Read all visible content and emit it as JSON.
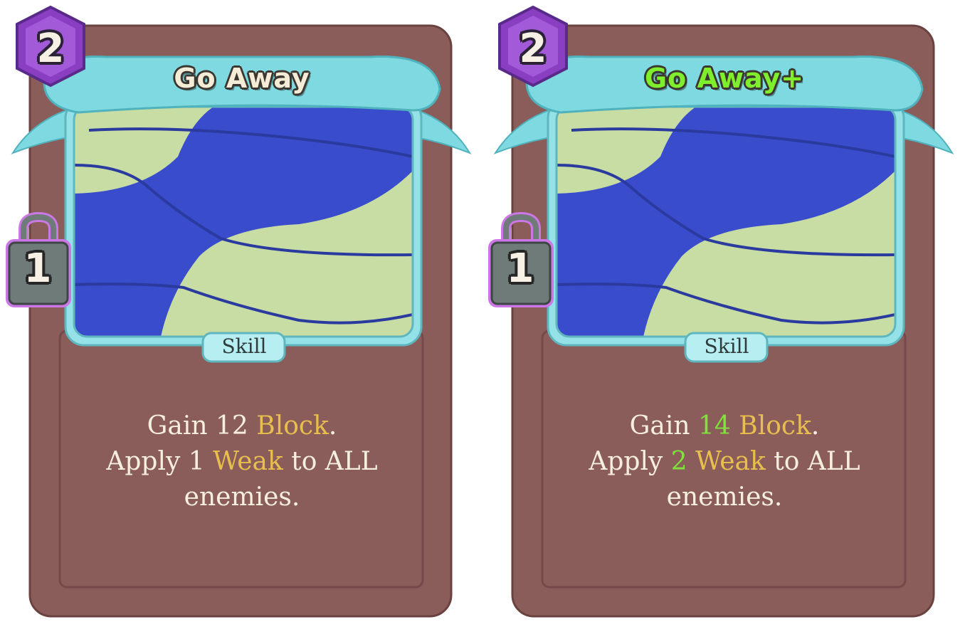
{
  "cards": [
    {
      "title": "Go Away",
      "cost": "2",
      "lock_value": "1",
      "type": "Skill",
      "desc": {
        "l1a": "Gain ",
        "l1num": "12",
        "l1b": " ",
        "l1kw": "Block",
        "l1c": ".",
        "l2a": "Apply ",
        "l2num": "1",
        "l2b": " ",
        "l2kw": "Weak",
        "l2c": " to ALL",
        "l3": "enemies."
      }
    },
    {
      "title": "Go Away+",
      "cost": "2",
      "lock_value": "1",
      "type": "Skill",
      "desc": {
        "l1a": "Gain ",
        "l1num": "14",
        "l1b": " ",
        "l1kw": "Block",
        "l1c": ".",
        "l2a": "Apply ",
        "l2num": "2",
        "l2b": " ",
        "l2kw": "Weak",
        "l2c": " to ALL",
        "l3": "enemies."
      }
    }
  ],
  "colors": {
    "card_body": "#8a5c5a",
    "card_border": "#6e4442",
    "banner": "#7fd9e0",
    "frame": "#94e2e8",
    "art_green": "#c7dda3",
    "art_blue": "#394ccb",
    "cost_gem": "#8a3fc2",
    "keyword": "#e8bf4e",
    "upgrade": "#7fe33a"
  },
  "icons": {
    "cost": "energy-gem-icon",
    "lock": "padlock-icon"
  }
}
